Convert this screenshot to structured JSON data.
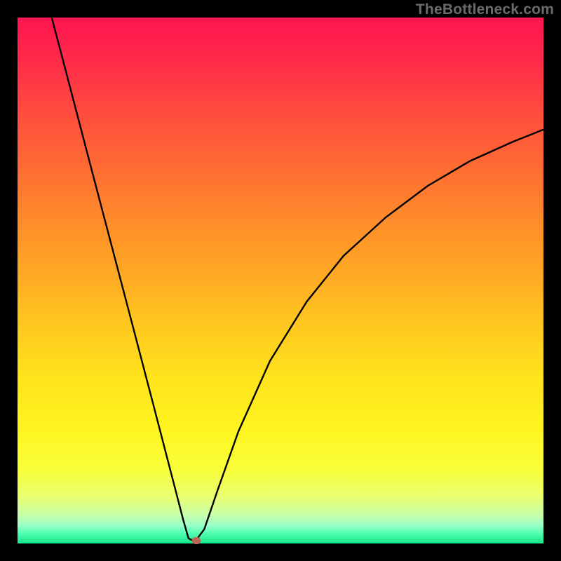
{
  "watermark": "TheBottleneck.com",
  "chart_data": {
    "type": "line",
    "title": "",
    "xlabel": "",
    "ylabel": "",
    "xlim": [
      0,
      100
    ],
    "ylim": [
      0,
      100
    ],
    "grid": false,
    "legend": false,
    "series": [
      {
        "name": "curve",
        "x": [
          6.5,
          10,
          14,
          18,
          22,
          26,
          28,
          30,
          31.5,
          32.5,
          33,
          34,
          35.5,
          38,
          42,
          48,
          55,
          62,
          70,
          78,
          86,
          94,
          100
        ],
        "values": [
          100,
          86.7,
          71.4,
          56.2,
          41.0,
          25.7,
          18.0,
          10.3,
          4.5,
          1.0,
          0.7,
          0.7,
          2.7,
          10.0,
          21.3,
          34.7,
          46.0,
          54.7,
          62.0,
          68.0,
          72.7,
          76.3,
          78.7
        ]
      }
    ],
    "marker": {
      "x": 34,
      "y": 0.5
    },
    "gradient_stops": [
      {
        "pos": 0,
        "color": "#ff1450"
      },
      {
        "pos": 8,
        "color": "#ff2a49"
      },
      {
        "pos": 18,
        "color": "#ff4c3e"
      },
      {
        "pos": 28,
        "color": "#ff6a34"
      },
      {
        "pos": 38,
        "color": "#ff8a2b"
      },
      {
        "pos": 48,
        "color": "#ffa724"
      },
      {
        "pos": 58,
        "color": "#ffc61f"
      },
      {
        "pos": 68,
        "color": "#ffe21c"
      },
      {
        "pos": 78,
        "color": "#fff41f"
      },
      {
        "pos": 86,
        "color": "#f9ff3a"
      },
      {
        "pos": 91,
        "color": "#e9ff70"
      },
      {
        "pos": 94.5,
        "color": "#c8ffa8"
      },
      {
        "pos": 96.5,
        "color": "#9effc9"
      },
      {
        "pos": 98,
        "color": "#55ffb4"
      },
      {
        "pos": 100,
        "color": "#13e689"
      }
    ]
  }
}
